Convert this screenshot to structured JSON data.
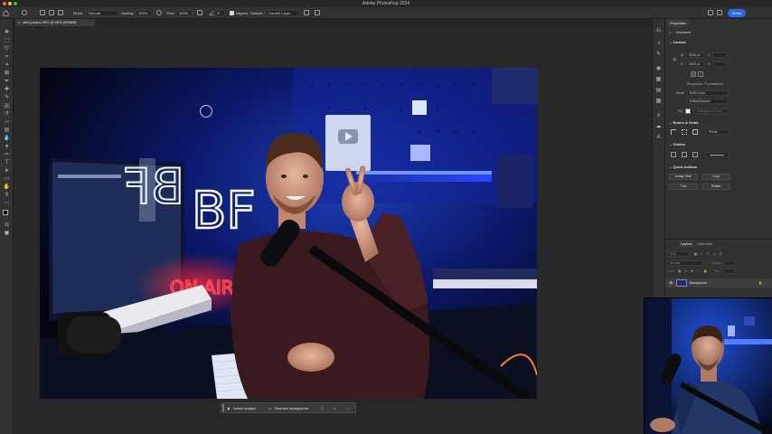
{
  "app": {
    "title": "Adobe Photoshop 2024",
    "document_tab": "chris peace.JPG @ 50% (RGB/8)"
  },
  "options_bar": {
    "mode_label": "Mode:",
    "mode_value": "Normal",
    "opacity_label": "Opacity:",
    "opacity_value": "100%",
    "flow_label": "Flow:",
    "flow_value": "100%",
    "angle_value": "0°",
    "aligned_label": "Aligned",
    "sample_label": "Sample:",
    "sample_value": "Current Layer",
    "share_label": "Share"
  },
  "photo": {
    "neon_main": "BF",
    "neon_mirror": "BF",
    "neon_sign": "ON AIR"
  },
  "contextual_taskbar": {
    "select_subject": "Select subject",
    "remove_background": "Remove background"
  },
  "properties": {
    "tab": "Properties",
    "document_label": "Document",
    "canvas_header": "Canvas",
    "w_label": "W",
    "w_value": "6000 px",
    "h_label": "H",
    "h_value": "4000 px",
    "x_label": "X",
    "y_label": "Y",
    "resolution": "Resolution: 72 pixels/inch",
    "mode_label": "Mode",
    "mode_value": "RGB Color",
    "depth_value": "8 Bits/Channel",
    "fill_label": "Fill",
    "fill_value": "Background Color",
    "rulers_header": "Rulers & Grids",
    "units_value": "Pixels",
    "guides_header": "Guides",
    "quick_actions_header": "Quick Actions",
    "btn_image_size": "Image Size",
    "btn_crop": "Crop",
    "btn_trim": "Trim",
    "btn_rotate": "Rotate"
  },
  "layers_panel": {
    "tab_layers": "Layers",
    "tab_channels": "Channels",
    "kind_label": "Kind",
    "blend_value": "Normal",
    "opacity_label": "Opacity:",
    "lock_label": "Lock:",
    "fill_label": "Fill:",
    "layer_name": "Background"
  },
  "colors": {
    "accent": "#2d68e8",
    "panel": "#323232",
    "canvas_bg": "#282828"
  }
}
